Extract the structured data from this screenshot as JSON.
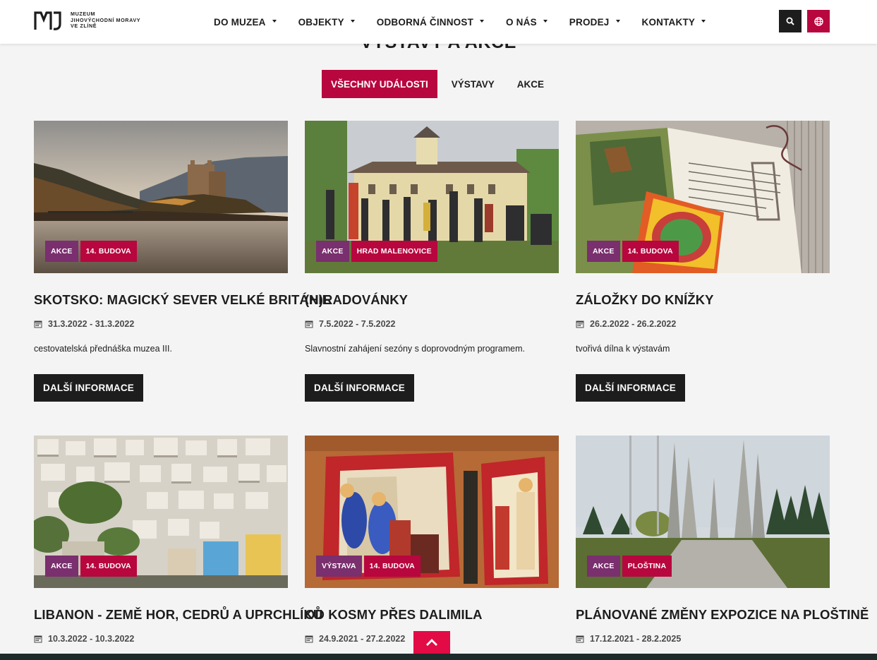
{
  "brand": {
    "logo_text_line1": "MUZEUM",
    "logo_text_line2": "JIHOVÝCHODNÍ MORAVY",
    "logo_text_line3": "VE ZLÍNĚ",
    "accent": "#b8063f",
    "tag_type_color": "#7a2f6e",
    "dark": "#1d1d1d"
  },
  "nav": {
    "items": [
      {
        "label": "DO MUZEA"
      },
      {
        "label": "OBJEKTY"
      },
      {
        "label": "ODBORNÁ ČINNOST"
      },
      {
        "label": "O NÁS"
      },
      {
        "label": "PRODEJ"
      },
      {
        "label": "KONTAKTY"
      }
    ],
    "search_icon": "search-icon",
    "language_icon": "globe-icon"
  },
  "section": {
    "title": "VÝSTAVY A AKCE"
  },
  "filters": {
    "all": "VŠECHNY UDÁLOSTI",
    "exhibitions": "VÝSTAVY",
    "events": "AKCE",
    "active": "all"
  },
  "cards": [
    {
      "type": "AKCE",
      "place": "14. BUDOVA",
      "title": "SKOTSKO: MAGICKÝ SEVER VELKÉ BRITÁNIE",
      "date": "31.3.2022 - 31.3.2022",
      "desc": "cestovatelská přednáška muzea III.",
      "button": "DALŠÍ INFORMACE"
    },
    {
      "type": "AKCE",
      "place": "HRAD MALENOVICE",
      "title": "(H)RADOVÁNKY",
      "date": "7.5.2022 - 7.5.2022",
      "desc": "Slavnostní zahájení sezóny s doprovodným programem.",
      "button": "DALŠÍ INFORMACE"
    },
    {
      "type": "AKCE",
      "place": "14. BUDOVA",
      "title": "ZÁLOŽKY DO KNÍŽKY",
      "date": "26.2.2022 - 26.2.2022",
      "desc": "tvořivá dílna k výstavám",
      "button": "DALŠÍ INFORMACE"
    },
    {
      "type": "AKCE",
      "place": "14. BUDOVA",
      "title": "LIBANON - ZEMĚ HOR, CEDRŮ A UPRCHLÍKŮ",
      "date": "10.3.2022 - 10.3.2022"
    },
    {
      "type": "VÝSTAVA",
      "place": "14. BUDOVA",
      "title": "OD KOSMY PŘES DALIMILA",
      "date": "24.9.2021 - 27.2.2022"
    },
    {
      "type": "AKCE",
      "place": "PLOŠTINA",
      "title": "PLÁNOVANÉ ZMĚNY EXPOZICE NA PLOŠTINĚ",
      "date": "17.12.2021 - 28.2.2025"
    }
  ],
  "back_to_top_icon": "chevron-up-icon"
}
